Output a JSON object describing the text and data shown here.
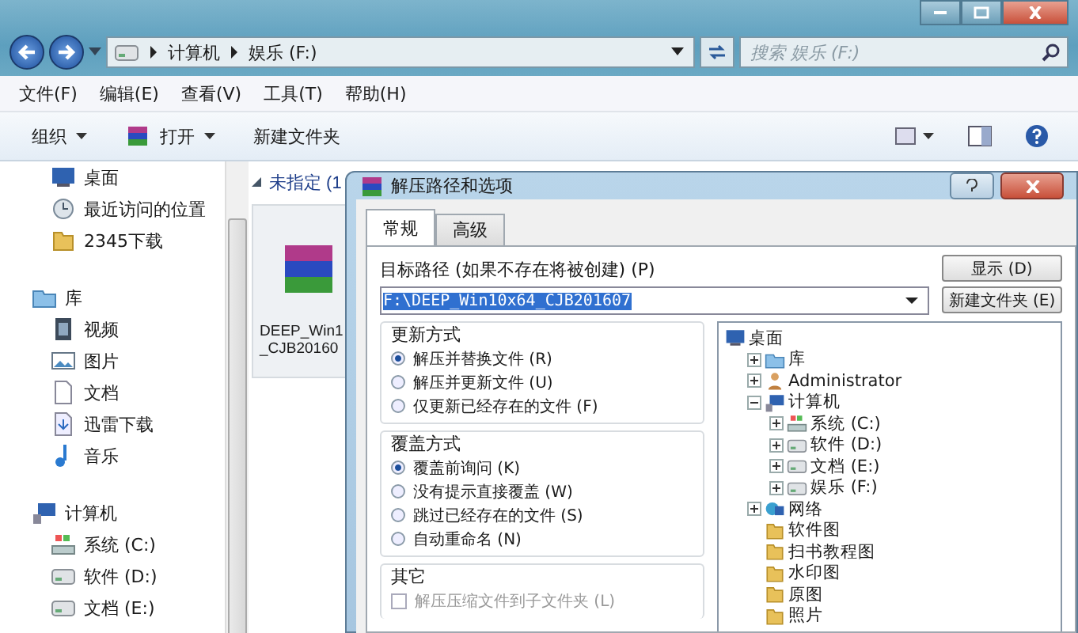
{
  "address": {
    "path": [
      "计算机",
      "娱乐 (F:)"
    ],
    "search": {
      "placeholder": "搜索 娱乐 (F:)"
    }
  },
  "menu": [
    "文件(F)",
    "编辑(E)",
    "查看(V)",
    "工具(T)",
    "帮助(H)"
  ],
  "toolbar": [
    {
      "label": "组织",
      "kind": "dropdown"
    },
    {
      "label": "打开",
      "kind": "archive-dropdown"
    },
    {
      "label": "新建文件夹",
      "kind": "plain"
    }
  ],
  "nav": [
    {
      "items": [
        {
          "label": "桌面",
          "kind": "desktop"
        },
        {
          "label": "最近访问的位置",
          "kind": "recent"
        },
        {
          "label": "2345下载",
          "kind": "folder"
        }
      ]
    },
    {
      "header": {
        "label": "库",
        "kind": "library"
      },
      "items": [
        {
          "label": "视频",
          "kind": "video"
        },
        {
          "label": "图片",
          "kind": "pictures"
        },
        {
          "label": "文档",
          "kind": "documents"
        },
        {
          "label": "迅雷下载",
          "kind": "download"
        },
        {
          "label": "音乐",
          "kind": "music"
        }
      ]
    },
    {
      "header": {
        "label": "计算机",
        "kind": "computer"
      },
      "items": [
        {
          "label": "系统 (C:)",
          "kind": "system-drive"
        },
        {
          "label": "软件 (D:)",
          "kind": "drive"
        },
        {
          "label": "文档 (E:)",
          "kind": "drive"
        }
      ]
    }
  ],
  "content": {
    "group": "未指定 (1",
    "files": [
      {
        "name_lines": [
          "DEEP_Win1",
          "_CJB20160"
        ]
      }
    ]
  },
  "dialog": {
    "title": "解压路径和选项",
    "tabs": [
      {
        "label": "常规",
        "selected": true
      },
      {
        "label": "高级",
        "selected": false
      }
    ],
    "path_label": "目标路径 (如果不存在将被创建) (P)",
    "path_value": "F:\\DEEP_Win10x64_CJB201607",
    "buttons": [
      "显示 (D)",
      "新建文件夹 (E)"
    ],
    "update_mode": {
      "title": "更新方式",
      "options": [
        {
          "label": "解压并替换文件 (R)",
          "selected": true
        },
        {
          "label": "解压并更新文件 (U)",
          "selected": false
        },
        {
          "label": "仅更新已经存在的文件 (F)",
          "selected": false
        }
      ]
    },
    "overwrite_mode": {
      "title": "覆盖方式",
      "options": [
        {
          "label": "覆盖前询问 (K)",
          "selected": true
        },
        {
          "label": "没有提示直接覆盖 (W)",
          "selected": false
        },
        {
          "label": "跳过已经存在的文件 (S)",
          "selected": false
        },
        {
          "label": "自动重命名 (N)",
          "selected": false
        }
      ]
    },
    "other": {
      "title": "其它",
      "options": [
        {
          "label": "解压压缩文件到子文件夹 (L)",
          "checked": false,
          "disabled": true
        }
      ]
    },
    "tree": [
      {
        "label": "桌面",
        "kind": "desktop",
        "children": [
          {
            "label": "库",
            "kind": "library",
            "expanded": false
          },
          {
            "label": "Administrator",
            "kind": "user",
            "expanded": false
          },
          {
            "label": "计算机",
            "kind": "computer",
            "expanded": true,
            "children": [
              {
                "label": "系统 (C:)",
                "kind": "system-drive",
                "expanded": false
              },
              {
                "label": "软件 (D:)",
                "kind": "drive",
                "expanded": false
              },
              {
                "label": "文档 (E:)",
                "kind": "drive",
                "expanded": false
              },
              {
                "label": "娱乐 (F:)",
                "kind": "drive",
                "expanded": false
              }
            ]
          },
          {
            "label": "网络",
            "kind": "network",
            "expanded": false
          },
          {
            "label": "软件图",
            "kind": "folder"
          },
          {
            "label": "扫书教程图",
            "kind": "folder"
          },
          {
            "label": "水印图",
            "kind": "folder"
          },
          {
            "label": "原图",
            "kind": "folder"
          },
          {
            "label": "照片",
            "kind": "folder"
          }
        ]
      }
    ]
  }
}
